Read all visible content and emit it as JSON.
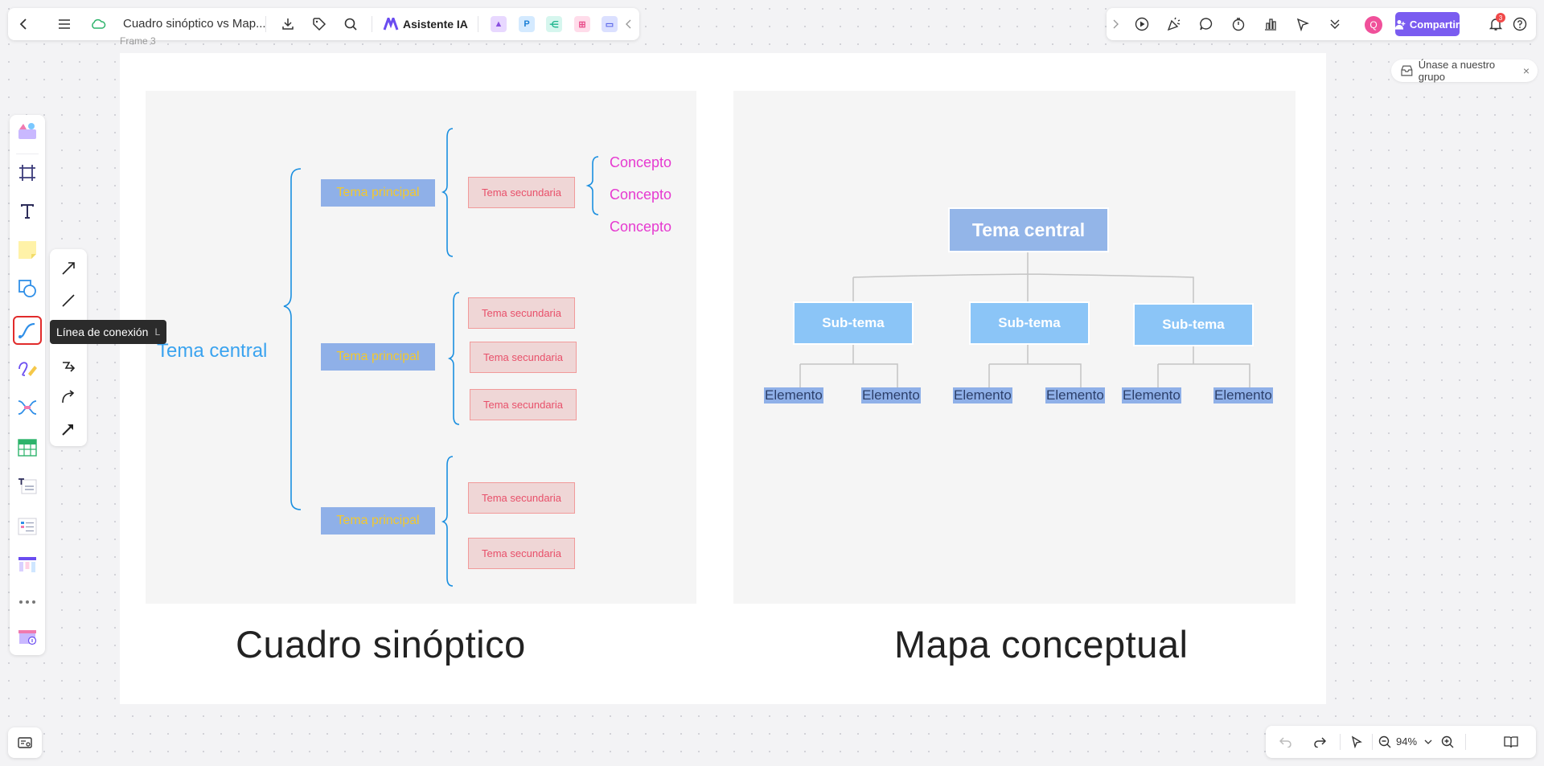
{
  "header": {
    "title": "Cuadro sinóptico vs Map...",
    "ai_label": "Asistente IA"
  },
  "header_right": {
    "avatar_initial": "Q",
    "share_label": "Compartir",
    "notification_count": "3"
  },
  "join_group": {
    "label": "Únase a nuestro grupo"
  },
  "toolbar": {
    "tooltip_label": "Línea de conexión",
    "tooltip_shortcut": "L"
  },
  "canvas": {
    "frame_label": "Frame 3",
    "synoptic": {
      "title": "Cuadro sinóptico",
      "central": "Tema central",
      "principal_label": "Tema principal",
      "secondary_label": "Tema secundaria",
      "concept_label": "Concepto"
    },
    "concept_map": {
      "title": "Mapa conceptual",
      "central": "Tema central",
      "sub_label": "Sub-tema",
      "element_label": "Elemento"
    }
  },
  "zoom": {
    "level": "94%"
  },
  "colors": {
    "accent": "#7a5cf0",
    "bracket": "#1a8fe0",
    "concept": "#e63ad0",
    "principal_fill": "#8fb0e8",
    "principal_text": "#f2c82f"
  }
}
